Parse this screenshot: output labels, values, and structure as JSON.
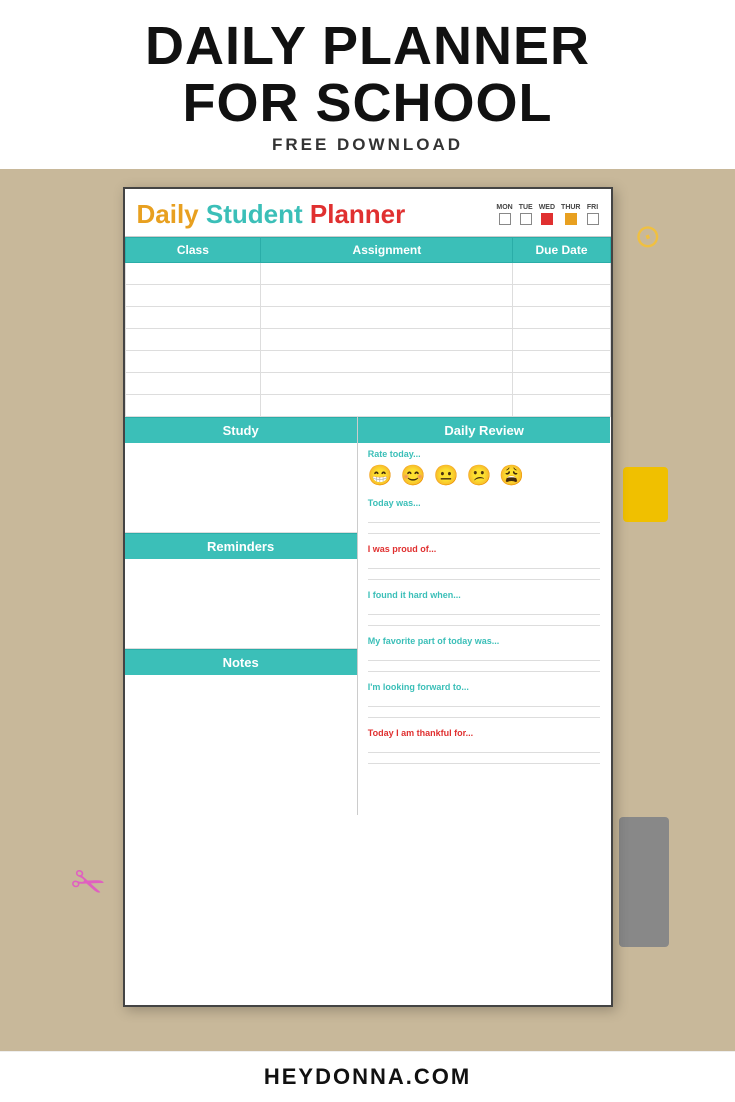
{
  "header": {
    "title_line1": "DAILY PLANNER",
    "title_line2": "FOR SCHOOL",
    "subtitle": "FREE DOWNLOAD"
  },
  "footer": {
    "website": "HEYDONNA.COM"
  },
  "planner": {
    "title": {
      "daily": "Daily",
      "student": "Student",
      "planner": "Planner"
    },
    "days": [
      {
        "label": "MON",
        "checked": false
      },
      {
        "label": "TUE",
        "checked": false
      },
      {
        "label": "WED",
        "checked": true
      },
      {
        "label": "THUR",
        "checked": false
      },
      {
        "label": "FRI",
        "checked": false
      }
    ],
    "assignment_table": {
      "headers": [
        "Class",
        "Assignment",
        "Due Date"
      ],
      "rows": 7
    },
    "sections": {
      "study": "Study",
      "daily_review": "Daily Review",
      "reminders": "Reminders",
      "notes": "Notes"
    },
    "daily_review": {
      "rate_label": "Rate today...",
      "emojis": [
        "😁",
        "😊",
        "😐",
        "😕",
        "😩"
      ],
      "prompts": [
        {
          "label": "Today was...",
          "color": "teal"
        },
        {
          "label": "I was proud of...",
          "color": "red"
        },
        {
          "label": "I found it hard when...",
          "color": "teal"
        },
        {
          "label": "My favorite part of today was...",
          "color": "teal"
        },
        {
          "label": "I'm looking forward to...",
          "color": "teal"
        },
        {
          "label": "Today I am thankful for...",
          "color": "red"
        }
      ]
    }
  }
}
